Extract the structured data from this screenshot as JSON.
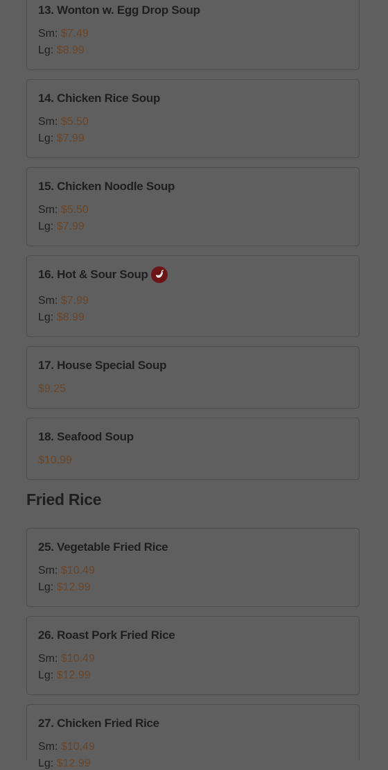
{
  "soups": [
    {
      "name": "13. Wonton w. Egg Drop Soup",
      "prices": [
        {
          "label": "Sm:",
          "value": "$7.49"
        },
        {
          "label": "Lg:",
          "value": "$8.99"
        }
      ]
    },
    {
      "name": "14. Chicken Rice Soup",
      "prices": [
        {
          "label": "Sm:",
          "value": "$5.50"
        },
        {
          "label": "Lg:",
          "value": "$7.99"
        }
      ]
    },
    {
      "name": "15. Chicken Noodle Soup",
      "prices": [
        {
          "label": "Sm:",
          "value": "$5.50"
        },
        {
          "label": "Lg:",
          "value": "$7.99"
        }
      ]
    },
    {
      "name": "16. Hot & Sour Soup",
      "spicy": true,
      "prices": [
        {
          "label": "Sm:",
          "value": "$7.99"
        },
        {
          "label": "Lg:",
          "value": "$8.99"
        }
      ]
    },
    {
      "name": "17. House Special Soup",
      "price": "$9.25"
    },
    {
      "name": "18. Seafood Soup",
      "price": "$10.99"
    }
  ],
  "fried_rice_section": {
    "title": "Fried Rice",
    "items": [
      {
        "name": "25. Vegetable Fried Rice",
        "prices": [
          {
            "label": "Sm:",
            "value": "$10.49"
          },
          {
            "label": "Lg:",
            "value": "$12.99"
          }
        ]
      },
      {
        "name": "26. Roast Pork Fried Rice",
        "prices": [
          {
            "label": "Sm:",
            "value": "$10.49"
          },
          {
            "label": "Lg:",
            "value": "$12.99"
          }
        ]
      },
      {
        "name": "27. Chicken Fried Rice",
        "prices": [
          {
            "label": "Sm:",
            "value": "$10.49"
          },
          {
            "label": "Lg:",
            "value": "$12.99"
          }
        ]
      }
    ]
  },
  "icons": {
    "spicy": "chili-pepper-icon"
  },
  "colors": {
    "overlay": "#5f5f5f",
    "price": "#6a4528",
    "spicy_badge": "#6b1518"
  }
}
